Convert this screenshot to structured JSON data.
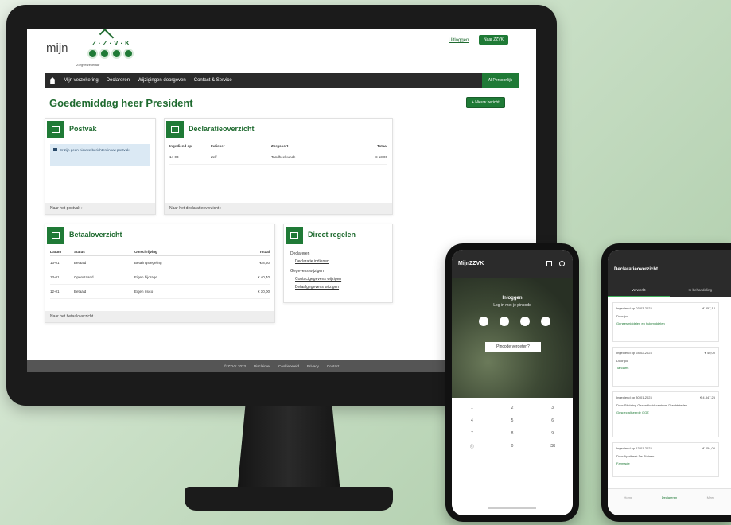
{
  "desktop": {
    "logo": {
      "mijn": "mijn",
      "letters": "Z·Z·V·K",
      "tagline": "Zorgverzekeraar"
    },
    "header": {
      "logout": "Uitloggen",
      "go_button": "Naar ZZVK"
    },
    "nav": {
      "items": [
        "Mijn verzekering",
        "Declareren",
        "Wijzigingen doorgeven",
        "Contact & Service"
      ],
      "person": "Al Persoonlijk"
    },
    "greeting": "Goedemiddag heer President",
    "new_button": "+ Nieuw bericht",
    "postvak": {
      "title": "Postvak",
      "message": "Er zijn geen nieuwe berichten in uw postvak",
      "footer": "Naar het postvak ›"
    },
    "declaratie": {
      "title": "Declaratieoverzicht",
      "headers": [
        "Ingediend op",
        "Indiener",
        "Zorgsoort",
        "Totaal"
      ],
      "rows": [
        [
          "14-03",
          "Zelf",
          "Tandheelkunde",
          "€ 13,00"
        ]
      ],
      "footer": "Naar het declaratieoverzicht ›"
    },
    "betaal": {
      "title": "Betaaloverzicht",
      "headers": [
        "Datum",
        "Status",
        "Omschrijving",
        "Totaal"
      ],
      "rows": [
        [
          "13-01",
          "Betaald",
          "Betalingsregeling",
          "€ 8,60"
        ],
        [
          "13-01",
          "Openstaand",
          "Eigen bijdrage",
          "€ 40,40"
        ],
        [
          "12-01",
          "Betaald",
          "Eigen risico",
          "€ 30,00"
        ]
      ],
      "footer": "Naar het betaaloverzicht ›"
    },
    "direct": {
      "title": "Direct regelen",
      "section1": "Declareren",
      "link1": "Declaratie indienen",
      "section2": "Gegevens wijzigen",
      "link2": "Contactgegevens wijzigen",
      "link3": "Betaalgegevens wijzigen"
    },
    "footer": [
      "© ZZVK 2023",
      "Disclaimer",
      "Cookiebeleid",
      "Privacy",
      "Contact"
    ]
  },
  "phone_login": {
    "app_title": "MijnZZVK",
    "title": "Inloggen",
    "subtitle": "Log in met je pincode",
    "forgot_button": "Pincode vergeten?",
    "keys": [
      "1",
      "2",
      "3",
      "4",
      "5",
      "6",
      "7",
      "8",
      "9",
      "⦿",
      "0",
      "⌫"
    ]
  },
  "phone_decl": {
    "title": "Declaratieoverzicht",
    "tabs": [
      "Verwerkt",
      "In behandeling"
    ],
    "cards": [
      {
        "date": "Ingediend op 03-03-2023",
        "amount": "€ 857,14",
        "by": "Door jou",
        "type": "Geneesmiddelen en hulpmiddelen"
      },
      {
        "date": "Ingediend op 28-02-2023",
        "amount": "€ 40,00",
        "by": "Door jou",
        "type": "Tandarts"
      },
      {
        "date": "Ingediend op 30-01-2023",
        "amount": "€ 4.847,25",
        "by": "Door Stichting Gezondheidscentrum Drechtsteden",
        "type": "Gespecialiseerde GGZ"
      },
      {
        "date": "Ingediend op 13-01-2023",
        "amount": "€ 254,00",
        "by": "Door Apotheek De Plataan",
        "type": "Farmacie"
      }
    ],
    "tabbar": [
      "Home",
      "Declareren",
      "Meer"
    ]
  }
}
